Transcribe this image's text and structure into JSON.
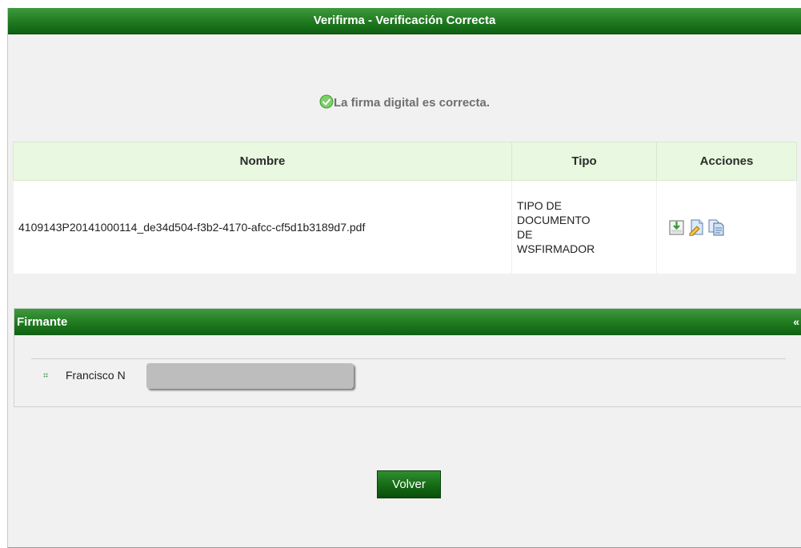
{
  "window": {
    "title": "Verifirma - Verificación Correcta"
  },
  "status": {
    "message": "La firma digital es correcta.",
    "icon": "check-circle-icon",
    "color": "#6f6f6f"
  },
  "table": {
    "headers": {
      "name": "Nombre",
      "type": "Tipo",
      "actions": "Acciones"
    },
    "rows": [
      {
        "name": "4109143P20141000114_de34d504-f3b2-4170-afcc-cf5d1b3189d7.pdf",
        "type_lines": [
          "TIPO DE",
          "DOCUMENTO",
          "DE",
          "WSFIRMADOR"
        ],
        "actions": [
          "download-document-icon",
          "edit-document-icon",
          "copy-document-icon"
        ]
      }
    ]
  },
  "firmante": {
    "title": "Firmante",
    "collapse_symbol": "«",
    "signers": [
      {
        "name": "Francisco N"
      }
    ]
  },
  "buttons": {
    "back": "Volver"
  },
  "colors": {
    "header_green": "#1f7a1f",
    "table_header_bg": "#e9f8e0",
    "panel_bg": "#f1f1f1"
  }
}
